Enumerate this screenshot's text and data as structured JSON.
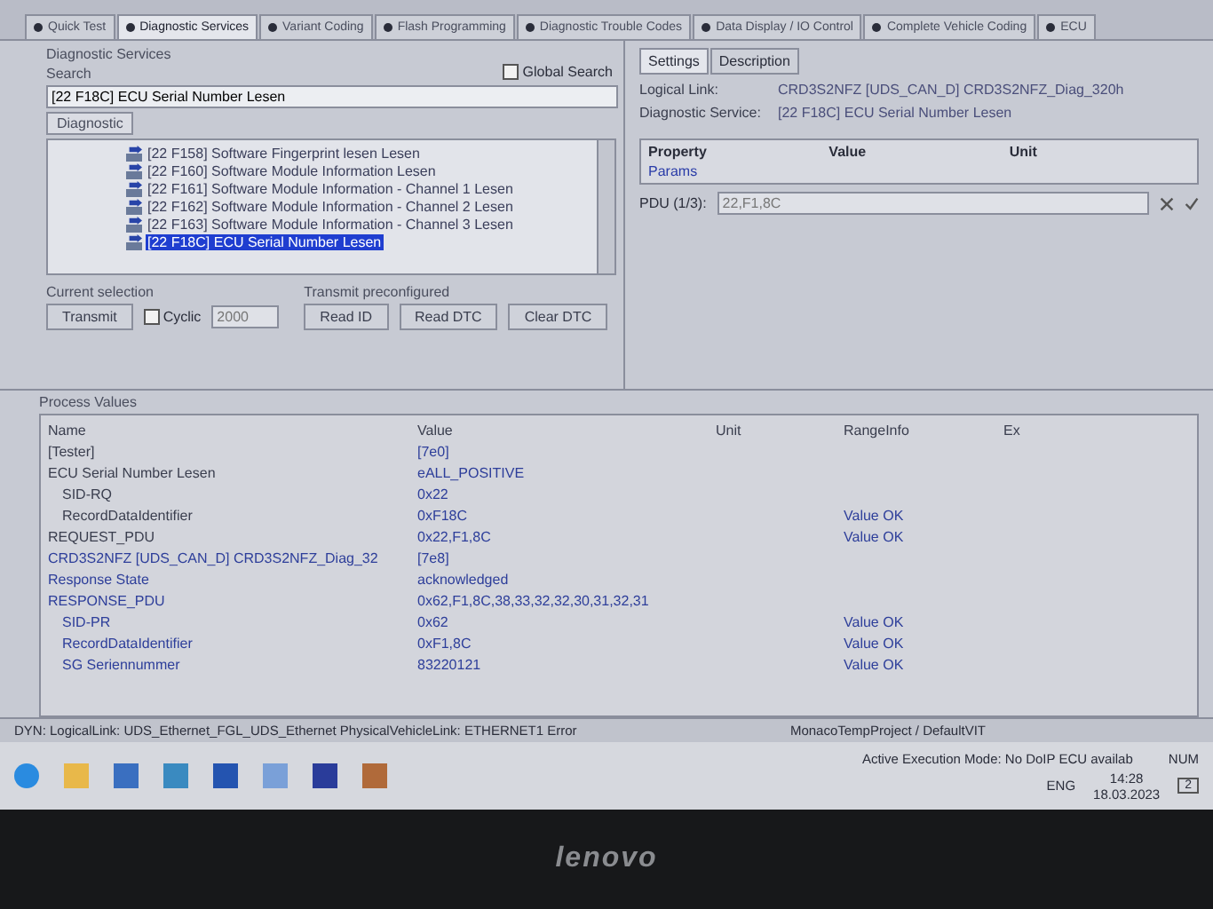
{
  "tabs": [
    {
      "label": "Quick Test",
      "selected": false
    },
    {
      "label": "Diagnostic Services",
      "selected": true
    },
    {
      "label": "Variant Coding",
      "selected": false
    },
    {
      "label": "Flash Programming",
      "selected": false
    },
    {
      "label": "Diagnostic Trouble Codes",
      "selected": false
    },
    {
      "label": "Data Display / IO Control",
      "selected": false
    },
    {
      "label": "Complete Vehicle Coding",
      "selected": false
    },
    {
      "label": "ECU",
      "selected": false
    }
  ],
  "services": {
    "group_title": "Diagnostic Services",
    "search_label": "Search",
    "search_value": "[22 F18C] ECU Serial Number Lesen",
    "global_search": {
      "label": "Global Search",
      "checked": false
    },
    "list_tab": "Diagnostic",
    "items": [
      {
        "label": "[22 F158] Software Fingerprint lesen Lesen",
        "selected": false
      },
      {
        "label": "[22 F160] Software Module Information Lesen",
        "selected": false
      },
      {
        "label": "[22 F161] Software Module Information - Channel 1 Lesen",
        "selected": false
      },
      {
        "label": "[22 F162] Software Module Information - Channel 2 Lesen",
        "selected": false
      },
      {
        "label": "[22 F163] Software Module Information - Channel 3 Lesen",
        "selected": false
      },
      {
        "label": "[22 F18C] ECU Serial Number Lesen",
        "selected": true
      }
    ]
  },
  "current_selection": {
    "title": "Current selection",
    "transmit": "Transmit",
    "cyclic": {
      "label": "Cyclic",
      "checked": false
    },
    "interval": "2000"
  },
  "preconfigured": {
    "title": "Transmit preconfigured",
    "buttons": [
      "Read ID",
      "Read DTC",
      "Clear DTC"
    ]
  },
  "details": {
    "tabs": [
      {
        "label": "Settings",
        "selected": true
      },
      {
        "label": "Description",
        "selected": false
      }
    ],
    "logical_link": {
      "label": "Logical Link:",
      "value": "CRD3S2NFZ [UDS_CAN_D] CRD3S2NFZ_Diag_320h"
    },
    "diagnostic_service": {
      "label": "Diagnostic Service:",
      "value": "[22 F18C] ECU Serial Number Lesen"
    },
    "columns": [
      "Property",
      "Value",
      "Unit"
    ],
    "group": "Params",
    "pdu": {
      "label": "PDU (1/3):",
      "value": "22,F1,8C"
    }
  },
  "process_values": {
    "title": "Process Values",
    "columns": [
      "Name",
      "Value",
      "Unit",
      "RangeInfo",
      "Ex"
    ],
    "rows": [
      {
        "name": "[Tester]",
        "value": "[7e0]",
        "kind": "request"
      },
      {
        "name": "ECU Serial Number Lesen",
        "value": "eALL_POSITIVE",
        "kind": "request",
        "children": [
          {
            "name": "SID-RQ",
            "value": "0x22",
            "kind": "request"
          },
          {
            "name": "RecordDataIdentifier",
            "value": "0xF18C",
            "range": "Value OK",
            "kind": "request"
          }
        ]
      },
      {
        "name": "REQUEST_PDU",
        "value": "0x22,F1,8C",
        "range": "Value OK",
        "kind": "request"
      },
      {
        "name": "CRD3S2NFZ [UDS_CAN_D] CRD3S2NFZ_Diag_32",
        "value": "[7e8]",
        "kind": "response"
      },
      {
        "name": "Response State",
        "value": "acknowledged",
        "kind": "response"
      },
      {
        "name": "RESPONSE_PDU",
        "value": "0x62,F1,8C,38,33,32,32,30,31,32,31",
        "kind": "response",
        "children": [
          {
            "name": "SID-PR",
            "value": "0x62",
            "range": "Value OK",
            "kind": "response"
          },
          {
            "name": "RecordDataIdentifier",
            "value": "0xF1,8C",
            "range": "Value OK",
            "kind": "response"
          },
          {
            "name": "SG Seriennummer",
            "value": "83220121",
            "range": "Value OK",
            "kind": "response"
          }
        ]
      }
    ]
  },
  "status_bar": {
    "connection": "DYN: LogicalLink: UDS_Ethernet_FGL_UDS_Ethernet PhysicalVehicleLink: ETHERNET1 Error",
    "project": "MonacoTempProject / DefaultVIT",
    "mode": "Active Execution Mode: No DoIP ECU availab",
    "num": "NUM"
  },
  "taskbar": {
    "language": "ENG",
    "time": "14:28",
    "date": "18.03.2023",
    "notifications": "2"
  },
  "bezel": {
    "logo": "lenovo"
  }
}
